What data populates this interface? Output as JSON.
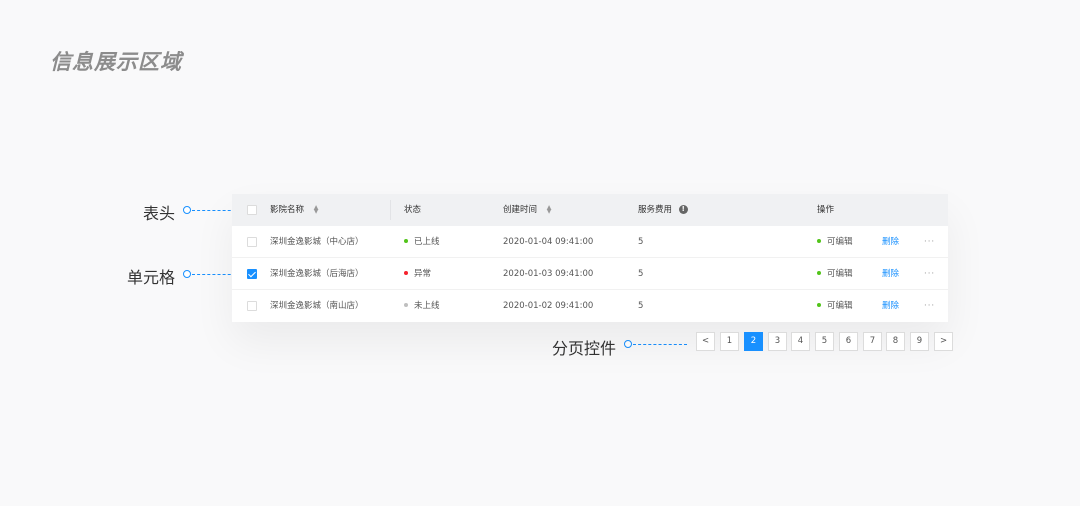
{
  "page_title": "信息展示区域",
  "callouts": {
    "header": "表头",
    "cell": "单元格",
    "pagination": "分页控件"
  },
  "table": {
    "columns": {
      "name": "影院名称",
      "status": "状态",
      "created": "创建时间",
      "fee": "服务费用",
      "operation": "操作"
    },
    "rows": [
      {
        "checked": false,
        "name": "深圳金逸影城（中心店）",
        "status": "已上线",
        "status_color": "#52c41a",
        "created": "2020-01-04  09:41:00",
        "fee": "5",
        "op_status": "可编辑",
        "op_color": "#52c41a",
        "delete": "删除",
        "more": "···"
      },
      {
        "checked": true,
        "name": "深圳金逸影城（后海店）",
        "status": "异常",
        "status_color": "#f5222d",
        "created": "2020-01-03  09:41:00",
        "fee": "5",
        "op_status": "可编辑",
        "op_color": "#52c41a",
        "delete": "删除",
        "more": "···"
      },
      {
        "checked": false,
        "name": "深圳金逸影城（南山店）",
        "status": "未上线",
        "status_color": "#bfbfbf",
        "created": "2020-01-02  09:41:00",
        "fee": "5",
        "op_status": "可编辑",
        "op_color": "#52c41a",
        "delete": "删除",
        "more": "···"
      }
    ]
  },
  "pagination": {
    "prev": "<",
    "next": ">",
    "pages": [
      "1",
      "2",
      "3",
      "4",
      "5",
      "6",
      "7",
      "8",
      "9"
    ],
    "current": "2"
  },
  "colors": {
    "accent": "#1890ff"
  }
}
